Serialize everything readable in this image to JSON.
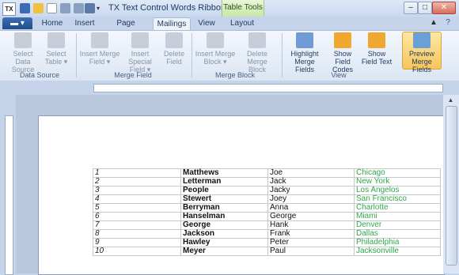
{
  "window": {
    "app_icon_text": "TX",
    "title": "TX Text Control Words Ribbon – [unt...",
    "context_tab": "Table Tools"
  },
  "file_button": "▬ ▾",
  "tabs": [
    "Home",
    "Insert",
    "Page Layout",
    "Mailings",
    "View",
    "Layout"
  ],
  "active_tab": "Mailings",
  "ribbon": {
    "groups": [
      {
        "label": "Data Source",
        "buttons": [
          {
            "label": "Select Data Source"
          },
          {
            "label": "Select Table ▾"
          }
        ]
      },
      {
        "label": "Merge Field",
        "buttons": [
          {
            "label": "Insert Merge Field ▾"
          },
          {
            "label": "Insert Special Field ▾"
          },
          {
            "label": "Delete Field"
          }
        ]
      },
      {
        "label": "Merge Block",
        "buttons": [
          {
            "label": "Insert Merge Block ▾"
          },
          {
            "label": "Delete Merge Block"
          }
        ]
      },
      {
        "label": "View",
        "buttons": [
          {
            "label": "Highlight Merge Fields"
          },
          {
            "label": "Show Field Codes"
          },
          {
            "label": "Show Field Text"
          },
          {
            "label": "Preview Merge Fields"
          }
        ]
      }
    ]
  },
  "colors": {
    "city_text": "#2ea84a",
    "active_button": "#f7c55b"
  },
  "table_rows": [
    {
      "num": "1",
      "last": "Matthews",
      "first": "Joe",
      "city": "Chicago"
    },
    {
      "num": "2",
      "last": "Letterman",
      "first": "Jack",
      "city": "New York"
    },
    {
      "num": "3",
      "last": "People",
      "first": "Jacky",
      "city": "Los Angelos"
    },
    {
      "num": "4",
      "last": "Stewert",
      "first": "Joey",
      "city": "San Francisco"
    },
    {
      "num": "5",
      "last": "Berryman",
      "first": "Anna",
      "city": "Charlotte"
    },
    {
      "num": "6",
      "last": "Hanselman",
      "first": "George",
      "city": "Miami"
    },
    {
      "num": "7",
      "last": "George",
      "first": "Hank",
      "city": "Denver"
    },
    {
      "num": "8",
      "last": "Jackson",
      "first": "Frank",
      "city": "Dallas"
    },
    {
      "num": "9",
      "last": "Hawley",
      "first": "Peter",
      "city": "Philadelphia"
    },
    {
      "num": "10",
      "last": "Meyer",
      "first": "Paul",
      "city": "Jacksonville"
    }
  ]
}
